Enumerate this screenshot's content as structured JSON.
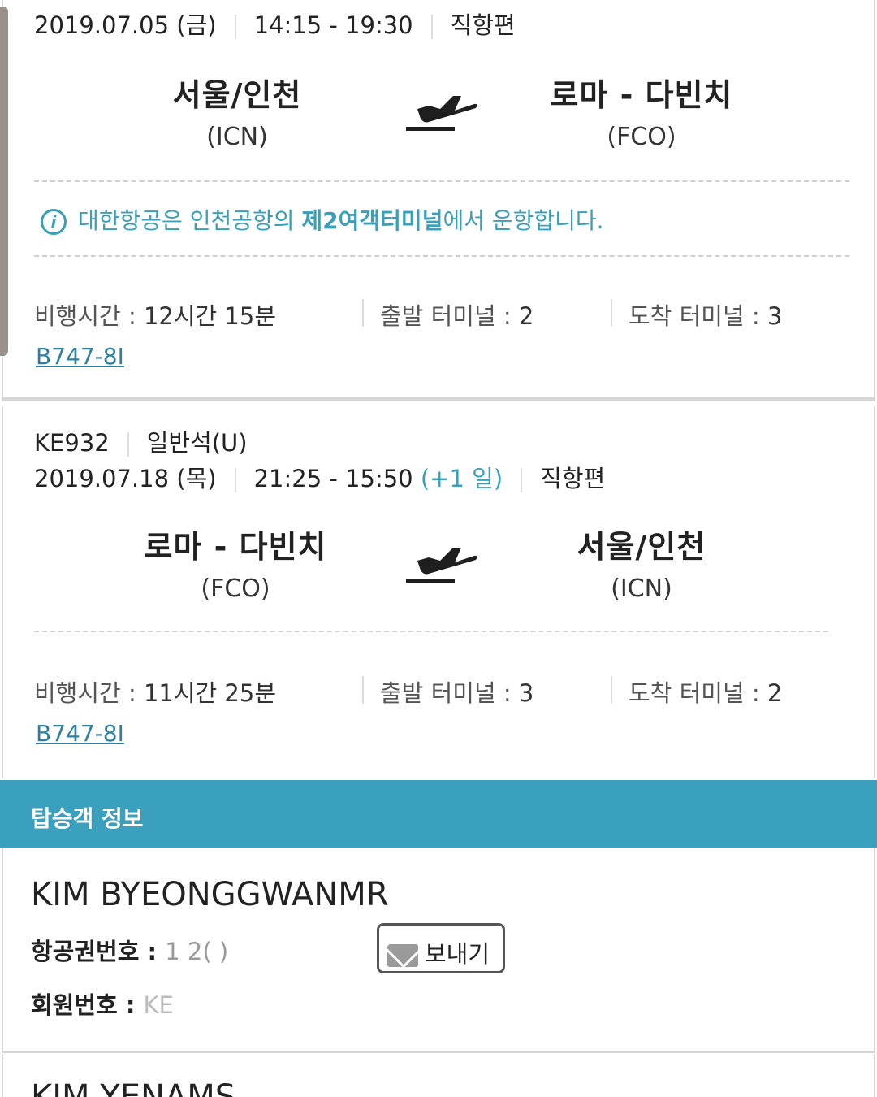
{
  "flight1": {
    "date": "2019.07.05 (금)",
    "time": "14:15 - 19:30",
    "type": "직항편",
    "origin": {
      "city": "서울/인천",
      "code": "(ICN)"
    },
    "destination": {
      "city": "로마 - 다빈치",
      "code": "(FCO)"
    },
    "notice_pre": "대한항공은 인천공항의 ",
    "notice_bold": "제2여객터미널",
    "notice_post": "에서 운항합니다.",
    "duration_label": "비행시간 : ",
    "duration": "12시간 15분",
    "dep_terminal_label": "출발 터미널 : ",
    "dep_terminal": "2",
    "arr_terminal_label": "도착 터미널 : ",
    "arr_terminal": "3",
    "aircraft": "B747-8I"
  },
  "flight2": {
    "flight_no": "KE932",
    "cabin": "일반석(U)",
    "date": "2019.07.18 (목)",
    "time": "21:25 - 15:50",
    "next_day": "(+1 일)",
    "type": "직항편",
    "origin": {
      "city": "로마 - 다빈치",
      "code": "(FCO)"
    },
    "destination": {
      "city": "서울/인천",
      "code": "(ICN)"
    },
    "duration_label": "비행시간 : ",
    "duration": "11시간 25분",
    "dep_terminal_label": "출발 터미널 : ",
    "dep_terminal": "3",
    "arr_terminal_label": "도착 터미널 : ",
    "arr_terminal": "2",
    "aircraft": "B747-8I"
  },
  "passengers": {
    "header": "탑승객 정보",
    "items": [
      {
        "name": "KIM BYEONGGWANMR",
        "ticket_label": "항공권번호 : ",
        "ticket_value": "1           2(     )",
        "member_label": "회원번호 : ",
        "member_value": "KE",
        "send_label": "보내기"
      },
      {
        "name": "KIM YENAMS"
      }
    ]
  },
  "colors": {
    "accent": "#3aa0b9",
    "header_bg": "#3aa0be",
    "link": "#2f7f9e"
  }
}
